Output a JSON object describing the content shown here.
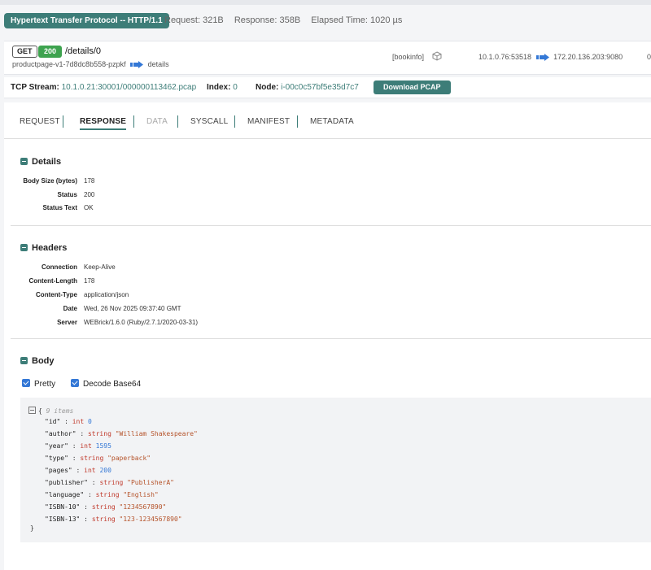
{
  "header": {
    "protocol": "Hypertext Transfer Protocol -- HTTP/1.1",
    "request": "Request: 321B",
    "response": "Response: 358B",
    "elapsed": "Elapsed Time: 1020 µs"
  },
  "request_row": {
    "method": "GET",
    "status": "200",
    "path": "/details/0",
    "source_pod": "productpage-v1-7d8dc8b558-pzpkf",
    "dest_service": "details",
    "namespace": "[bookinfo]",
    "src_addr": "10.1.0.76:53518",
    "dst_addr": "172.20.136.203:9080",
    "tail": "0"
  },
  "stream_row": {
    "tcp_stream_label": "TCP Stream:",
    "tcp_stream_value": "10.1.0.21:30001/000000113462.pcap",
    "index_label": "Index:",
    "index_value": "0",
    "node_label": "Node:",
    "node_value": "i-00c0c57bf5e35d7c7",
    "download_label": "Download PCAP"
  },
  "tabs": [
    "REQUEST",
    "RESPONSE",
    "DATA",
    "SYSCALL",
    "MANIFEST",
    "METADATA"
  ],
  "active_tab": "RESPONSE",
  "details": {
    "title": "Details",
    "rows": [
      {
        "k": "Body Size (bytes)",
        "v": "178"
      },
      {
        "k": "Status",
        "v": "200"
      },
      {
        "k": "Status Text",
        "v": "OK"
      }
    ]
  },
  "headers": {
    "title": "Headers",
    "rows": [
      {
        "k": "Connection",
        "v": "Keep-Alive"
      },
      {
        "k": "Content-Length",
        "v": "178"
      },
      {
        "k": "Content-Type",
        "v": "application/json"
      },
      {
        "k": "Date",
        "v": "Wed, 26 Nov 2025 09:37:40 GMT"
      },
      {
        "k": "Server",
        "v": "WEBrick/1.6.0 (Ruby/2.7.1/2020-03-31)"
      }
    ]
  },
  "body": {
    "title": "Body",
    "pretty_label": "Pretty",
    "pretty_checked": true,
    "decode_label": "Decode Base64",
    "decode_checked": true,
    "items_count": "9 items",
    "entries": [
      {
        "key": "\"id\"",
        "type": "int",
        "value": "0",
        "kind": "num"
      },
      {
        "key": "\"author\"",
        "type": "string",
        "value": "\"William Shakespeare\"",
        "kind": "str"
      },
      {
        "key": "\"year\"",
        "type": "int",
        "value": "1595",
        "kind": "num"
      },
      {
        "key": "\"type\"",
        "type": "string",
        "value": "\"paperback\"",
        "kind": "str"
      },
      {
        "key": "\"pages\"",
        "type": "int",
        "value": "200",
        "kind": "num"
      },
      {
        "key": "\"publisher\"",
        "type": "string",
        "value": "\"PublisherA\"",
        "kind": "str"
      },
      {
        "key": "\"language\"",
        "type": "string",
        "value": "\"English\"",
        "kind": "str"
      },
      {
        "key": "\"ISBN-10\"",
        "type": "string",
        "value": "\"1234567890\"",
        "kind": "str"
      },
      {
        "key": "\"ISBN-13\"",
        "type": "string",
        "value": "\"123-1234567890\"",
        "kind": "str"
      }
    ]
  },
  "colors": {
    "accent": "#3d7d78",
    "status_ok": "#3ea34f",
    "checkbox": "#3478d6"
  }
}
